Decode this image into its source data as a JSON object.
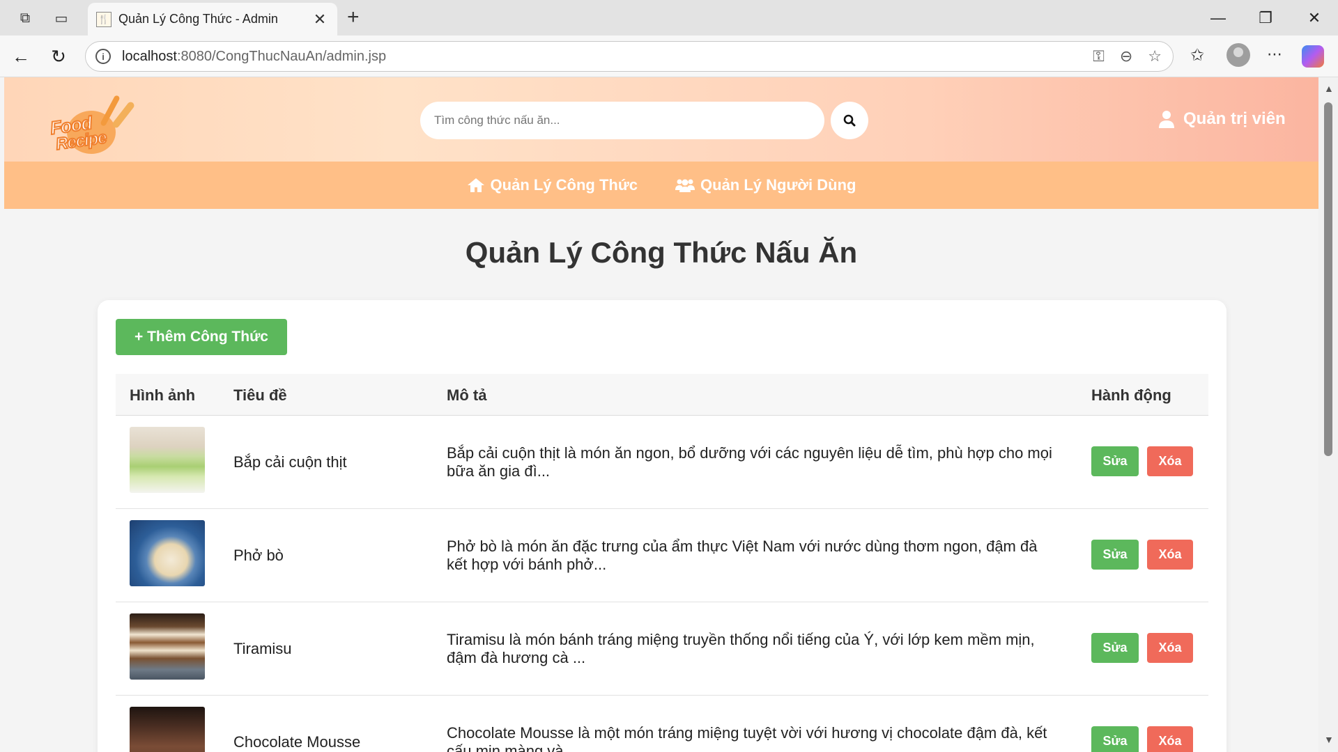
{
  "browser": {
    "tab_title": "Quản Lý Công Thức - Admin",
    "url_host": "localhost",
    "url_rest": ":8080/CongThucNauAn/admin.jsp"
  },
  "site": {
    "logo_line1": "Food",
    "logo_line2": "Recipe",
    "search_placeholder": "Tìm công thức nấu ăn...",
    "admin_label": "Quản trị viên",
    "menu": [
      {
        "label": "Quản Lý Công Thức",
        "icon": "home-icon"
      },
      {
        "label": "Quản Lý Người Dùng",
        "icon": "users-icon"
      }
    ],
    "colors": {
      "header_accent": "#ffbf87",
      "add_button": "#5cb85c",
      "delete_button": "#f06a5a"
    }
  },
  "main": {
    "title": "Quản Lý Công Thức Nấu Ăn",
    "add_button": "+ Thêm Công Thức",
    "table": {
      "headers": [
        "Hình ảnh",
        "Tiêu đề",
        "Mô tả",
        "Hành động"
      ],
      "edit_label": "Sửa",
      "delete_label": "Xóa",
      "rows": [
        {
          "title": "Bắp cải cuộn thịt",
          "desc": "Bắp cải cuộn thịt là món ăn ngon, bổ dưỡng với các nguyên liệu dễ tìm, phù hợp cho mọi bữa ăn gia đì..."
        },
        {
          "title": "Phở bò",
          "desc": "Phở bò là món ăn đặc trưng của ẩm thực Việt Nam với nước dùng thơm ngon, đậm đà kết hợp với bánh phở..."
        },
        {
          "title": "Tiramisu",
          "desc": "Tiramisu là món bánh tráng miệng truyền thống nổi tiếng của Ý, với lớp kem mềm mịn, đậm đà hương cà ..."
        },
        {
          "title": "Chocolate Mousse",
          "desc": "Chocolate Mousse là một món tráng miệng tuyệt vời với hương vị chocolate đậm đà, kết cấu mịn màng và..."
        }
      ]
    }
  }
}
